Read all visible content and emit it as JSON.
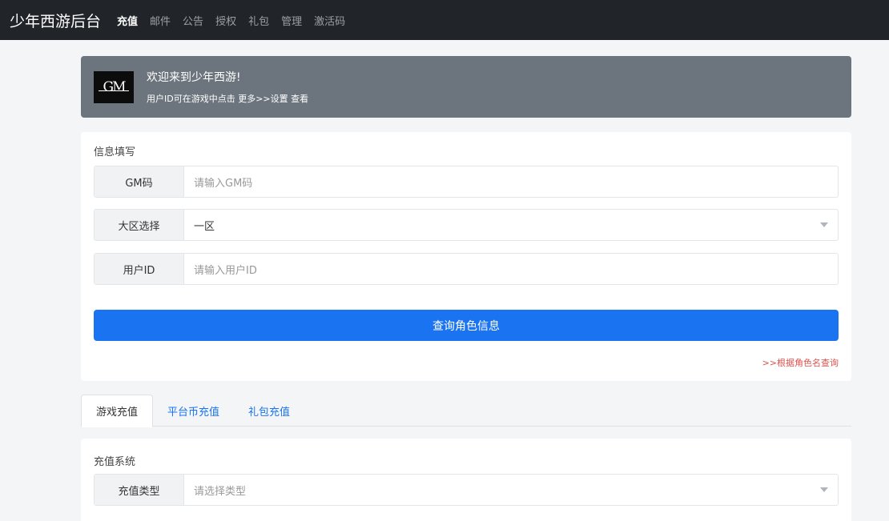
{
  "navbar": {
    "brand": "少年西游后台",
    "items": [
      "充值",
      "邮件",
      "公告",
      "授权",
      "礼包",
      "管理",
      "激活码"
    ]
  },
  "banner": {
    "logo_text": "GM",
    "title": "欢迎来到少年西游!",
    "subtitle": "用户ID可在游戏中点击 更多>>设置 查看"
  },
  "info_form": {
    "title": "信息填写",
    "gm_code_label": "GM码",
    "gm_code_placeholder": "请输入GM码",
    "region_label": "大区选择",
    "region_value": "一区",
    "user_id_label": "用户ID",
    "user_id_placeholder": "请输入用户ID",
    "query_button": "查询角色信息",
    "query_by_name_link": ">>根据角色名查询"
  },
  "tabs": [
    "游戏充值",
    "平台币充值",
    "礼包充值"
  ],
  "recharge": {
    "title": "充值系统",
    "type_label": "充值类型",
    "type_placeholder": "请选择类型"
  },
  "colors": {
    "navbar_bg": "#212529",
    "banner_bg": "#6c757d",
    "primary": "#1a73f0",
    "link_red": "#d9534f"
  }
}
